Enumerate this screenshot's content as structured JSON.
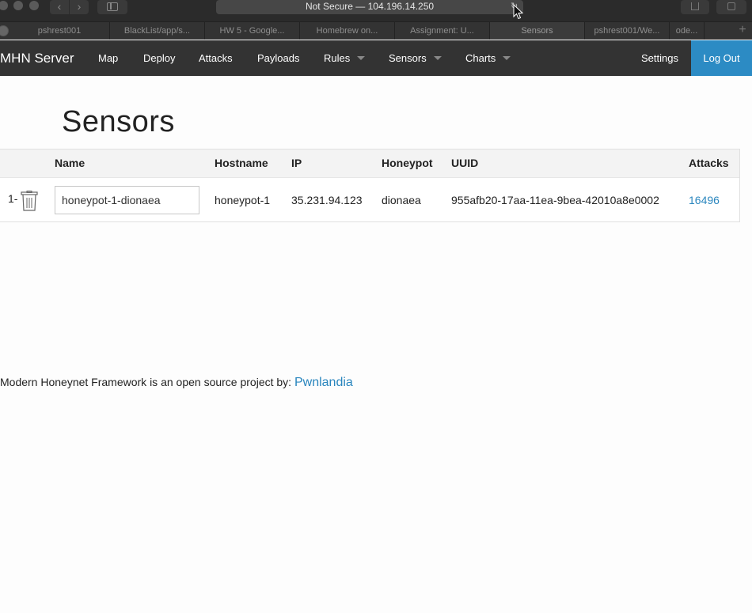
{
  "browser": {
    "url_text": "Not Secure — 104.196.14.250",
    "tabs": [
      {
        "label": "pshrest001"
      },
      {
        "label": "BlackList/app/s..."
      },
      {
        "label": "HW 5 - Google..."
      },
      {
        "label": "Homebrew on..."
      },
      {
        "label": "Assignment: U..."
      },
      {
        "label": "Sensors"
      },
      {
        "label": "pshrest001/We..."
      },
      {
        "label": "ode..."
      }
    ],
    "new_tab": "+"
  },
  "navbar": {
    "brand": "MHN Server",
    "items": [
      {
        "label": "Map"
      },
      {
        "label": "Deploy"
      },
      {
        "label": "Attacks"
      },
      {
        "label": "Payloads"
      },
      {
        "label": "Rules"
      },
      {
        "label": "Sensors"
      },
      {
        "label": "Charts"
      }
    ],
    "settings": "Settings",
    "logout": "Log Out"
  },
  "page": {
    "title": "Sensors",
    "table": {
      "headers": [
        "Name",
        "Hostname",
        "IP",
        "Honeypot",
        "UUID",
        "Attacks"
      ],
      "rows": [
        {
          "index": "1-",
          "name": "honeypot-1-dionaea",
          "hostname": "honeypot-1",
          "ip": "35.231.94.123",
          "honeypot": "dionaea",
          "uuid": "955afb20-17aa-11ea-9bea-42010a8e0002",
          "attacks": "16496"
        }
      ]
    }
  },
  "footer": {
    "text": "Modern Honeynet Framework is an open source project by: ",
    "link": "Pwnlandia"
  },
  "colors": {
    "navbar_bg": "#333333",
    "accent": "#2c8bc4",
    "link": "#2a86be"
  }
}
